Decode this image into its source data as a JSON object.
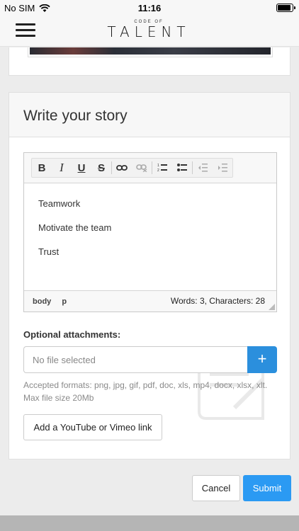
{
  "status_bar": {
    "carrier": "No SIM",
    "time": "11:16"
  },
  "logo": {
    "small": "CODE OF",
    "big": "TALENT"
  },
  "story_card": {
    "title": "Write your story"
  },
  "editor": {
    "toolbar": [
      {
        "name": "bold-button",
        "glyph": "B",
        "icon": "bold-icon"
      },
      {
        "name": "italic-button",
        "glyph": "I",
        "icon": "italic-icon"
      },
      {
        "name": "underline-button",
        "glyph": "U",
        "icon": "underline-icon"
      },
      {
        "name": "strike-button",
        "glyph": "S",
        "icon": "strikethrough-icon"
      }
    ],
    "content": [
      "Teamwork",
      "Motivate the team",
      "Trust"
    ],
    "path": [
      "body",
      "p"
    ],
    "word_count": "Words: 3, Characters: 28"
  },
  "attachments": {
    "label": "Optional attachments:",
    "placeholder": "No file selected",
    "add_icon": "+",
    "formats": "Accepted formats: png, jpg, gif, pdf, doc, xls, mp4, docx, xlsx, xlt. Max file size 20Mb"
  },
  "video_link_button": "Add a YouTube or Vimeo link",
  "actions": {
    "cancel": "Cancel",
    "submit": "Submit"
  },
  "colors": {
    "accent": "#2b9af3",
    "file_button": "#2b8fdd"
  }
}
